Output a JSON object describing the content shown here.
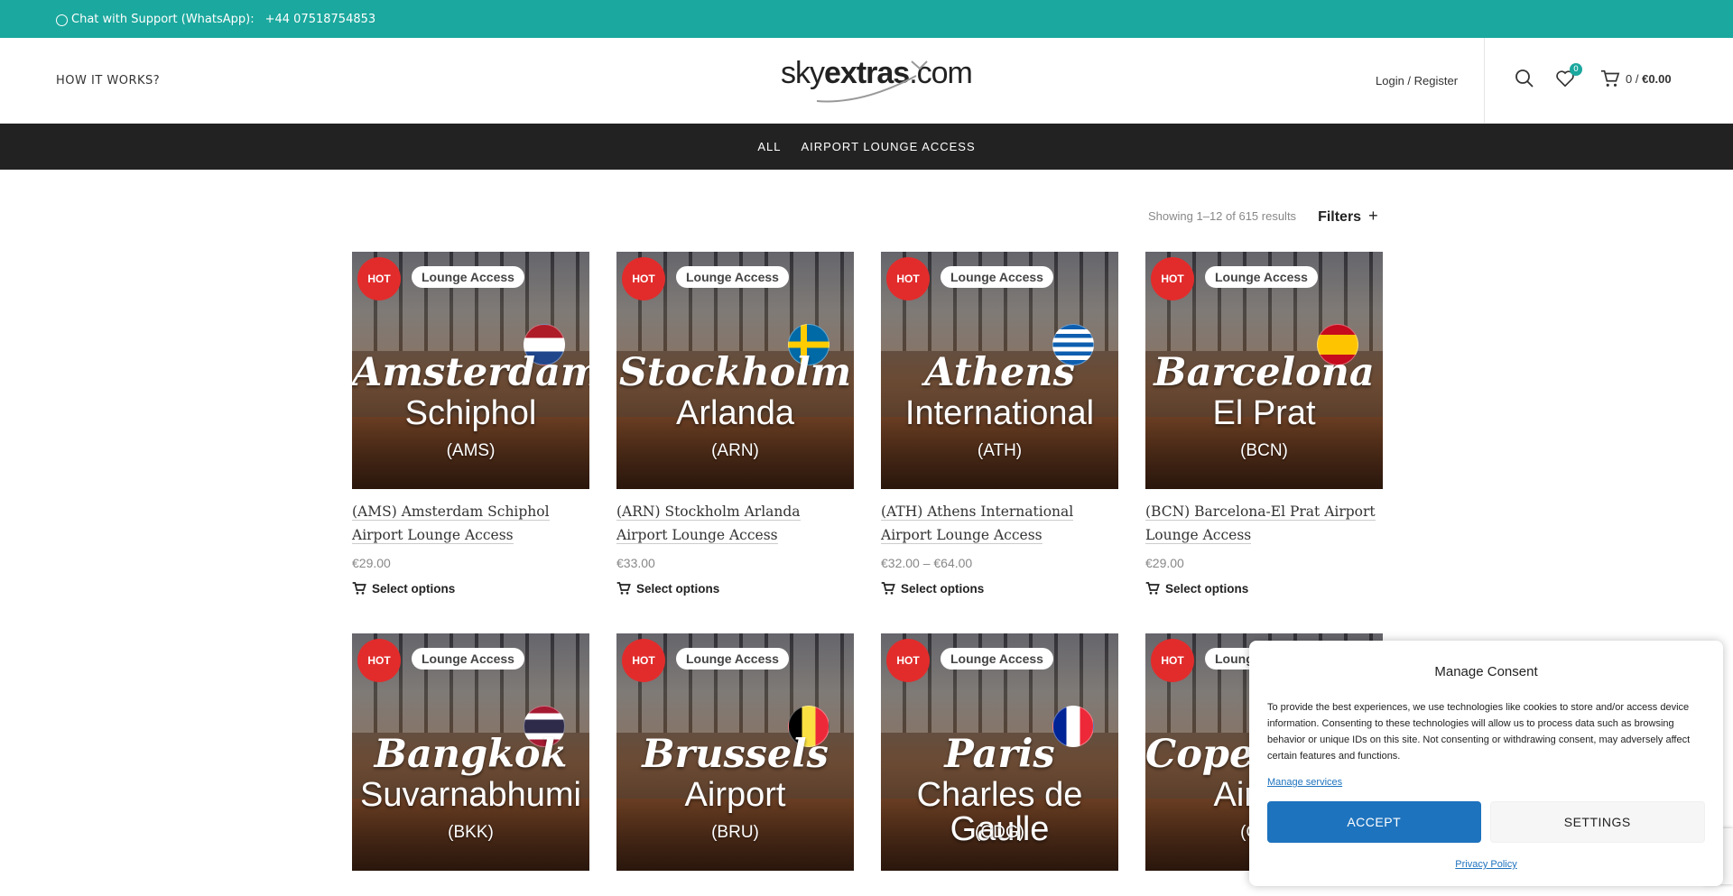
{
  "topbar": {
    "chat_label": "Chat with Support (WhatsApp):",
    "phone": "+44 07518754853"
  },
  "header": {
    "how_it_works": "HOW IT WORKS?",
    "logo_sky": "sky",
    "logo_extras": "extras",
    "logo_com": ".com",
    "login": "Login / Register",
    "wishlist_count": "0",
    "cart_count": "0 /",
    "cart_total": "€0.00"
  },
  "nav": {
    "items": [
      "ALL",
      "AIRPORT LOUNGE ACCESS"
    ]
  },
  "toolbar": {
    "showing": "Showing 1–12 of 615 results",
    "filters": "Filters",
    "filters_plus": "+"
  },
  "products": [
    {
      "hot": "HOT",
      "tag": "Lounge Access",
      "city": "Amsterdam",
      "sub": "Schiphol",
      "code": "(AMS)",
      "flag": "nl",
      "title": "(AMS) Amsterdam Schiphol Airport Lounge Access",
      "price": "€29.00",
      "action": "Select options"
    },
    {
      "hot": "HOT",
      "tag": "Lounge Access",
      "city": "Stockholm",
      "sub": "Arlanda",
      "code": "(ARN)",
      "flag": "se",
      "title": "(ARN) Stockholm Arlanda Airport Lounge Access",
      "price": "€33.00",
      "action": "Select options"
    },
    {
      "hot": "HOT",
      "tag": "Lounge Access",
      "city": "Athens",
      "sub": "International",
      "code": "(ATH)",
      "flag": "gr",
      "title": "(ATH) Athens International Airport Lounge Access",
      "price": "€32.00 – €64.00",
      "action": "Select options"
    },
    {
      "hot": "HOT",
      "tag": "Lounge Access",
      "city": "Barcelona",
      "sub": "El Prat",
      "code": "(BCN)",
      "flag": "es",
      "title": "(BCN) Barcelona-El Prat Airport Lounge Access",
      "price": "€29.00",
      "action": "Select options"
    },
    {
      "hot": "HOT",
      "tag": "Lounge Access",
      "city": "Bangkok",
      "sub": "Suvarnabhumi",
      "code": "(BKK)",
      "flag": "th"
    },
    {
      "hot": "HOT",
      "tag": "Lounge Access",
      "city": "Brussels",
      "sub": "Airport",
      "code": "(BRU)",
      "flag": "be"
    },
    {
      "hot": "HOT",
      "tag": "Lounge Access",
      "city": "Paris",
      "sub": "Charles de Gaulle",
      "code": "(CDG)",
      "flag": "fr"
    },
    {
      "hot": "HOT",
      "tag": "Lounge Access",
      "city": "Copenhagen",
      "sub": "Airport",
      "code": "(CPH)",
      "flag": "dk"
    }
  ],
  "consent": {
    "title": "Manage Consent",
    "body": "To provide the best experiences, we use technologies like cookies to store and/or access device information. Consenting to these technologies will allow us to process data such as browsing behavior or unique IDs on this site. Not consenting or withdrawing consent, may adversely affect certain features and functions.",
    "manage": "Manage services",
    "accept": "ACCEPT",
    "settings": "SETTINGS",
    "privacy": "Privacy Policy"
  },
  "colors": {
    "brand": "#1ba89e",
    "hot": "#e22c2c",
    "accept": "#1e73be",
    "nav": "#222222"
  }
}
